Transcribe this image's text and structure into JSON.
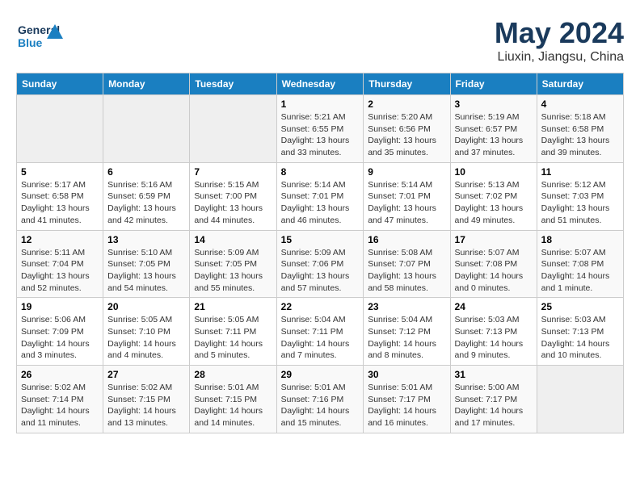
{
  "header": {
    "logo_line1": "General",
    "logo_line2": "Blue",
    "title": "May 2024",
    "subtitle": "Liuxin, Jiangsu, China"
  },
  "weekdays": [
    "Sunday",
    "Monday",
    "Tuesday",
    "Wednesday",
    "Thursday",
    "Friday",
    "Saturday"
  ],
  "weeks": [
    [
      {
        "day": "",
        "detail": ""
      },
      {
        "day": "",
        "detail": ""
      },
      {
        "day": "",
        "detail": ""
      },
      {
        "day": "1",
        "detail": "Sunrise: 5:21 AM\nSunset: 6:55 PM\nDaylight: 13 hours\nand 33 minutes."
      },
      {
        "day": "2",
        "detail": "Sunrise: 5:20 AM\nSunset: 6:56 PM\nDaylight: 13 hours\nand 35 minutes."
      },
      {
        "day": "3",
        "detail": "Sunrise: 5:19 AM\nSunset: 6:57 PM\nDaylight: 13 hours\nand 37 minutes."
      },
      {
        "day": "4",
        "detail": "Sunrise: 5:18 AM\nSunset: 6:58 PM\nDaylight: 13 hours\nand 39 minutes."
      }
    ],
    [
      {
        "day": "5",
        "detail": "Sunrise: 5:17 AM\nSunset: 6:58 PM\nDaylight: 13 hours\nand 41 minutes."
      },
      {
        "day": "6",
        "detail": "Sunrise: 5:16 AM\nSunset: 6:59 PM\nDaylight: 13 hours\nand 42 minutes."
      },
      {
        "day": "7",
        "detail": "Sunrise: 5:15 AM\nSunset: 7:00 PM\nDaylight: 13 hours\nand 44 minutes."
      },
      {
        "day": "8",
        "detail": "Sunrise: 5:14 AM\nSunset: 7:01 PM\nDaylight: 13 hours\nand 46 minutes."
      },
      {
        "day": "9",
        "detail": "Sunrise: 5:14 AM\nSunset: 7:01 PM\nDaylight: 13 hours\nand 47 minutes."
      },
      {
        "day": "10",
        "detail": "Sunrise: 5:13 AM\nSunset: 7:02 PM\nDaylight: 13 hours\nand 49 minutes."
      },
      {
        "day": "11",
        "detail": "Sunrise: 5:12 AM\nSunset: 7:03 PM\nDaylight: 13 hours\nand 51 minutes."
      }
    ],
    [
      {
        "day": "12",
        "detail": "Sunrise: 5:11 AM\nSunset: 7:04 PM\nDaylight: 13 hours\nand 52 minutes."
      },
      {
        "day": "13",
        "detail": "Sunrise: 5:10 AM\nSunset: 7:05 PM\nDaylight: 13 hours\nand 54 minutes."
      },
      {
        "day": "14",
        "detail": "Sunrise: 5:09 AM\nSunset: 7:05 PM\nDaylight: 13 hours\nand 55 minutes."
      },
      {
        "day": "15",
        "detail": "Sunrise: 5:09 AM\nSunset: 7:06 PM\nDaylight: 13 hours\nand 57 minutes."
      },
      {
        "day": "16",
        "detail": "Sunrise: 5:08 AM\nSunset: 7:07 PM\nDaylight: 13 hours\nand 58 minutes."
      },
      {
        "day": "17",
        "detail": "Sunrise: 5:07 AM\nSunset: 7:08 PM\nDaylight: 14 hours\nand 0 minutes."
      },
      {
        "day": "18",
        "detail": "Sunrise: 5:07 AM\nSunset: 7:08 PM\nDaylight: 14 hours\nand 1 minute."
      }
    ],
    [
      {
        "day": "19",
        "detail": "Sunrise: 5:06 AM\nSunset: 7:09 PM\nDaylight: 14 hours\nand 3 minutes."
      },
      {
        "day": "20",
        "detail": "Sunrise: 5:05 AM\nSunset: 7:10 PM\nDaylight: 14 hours\nand 4 minutes."
      },
      {
        "day": "21",
        "detail": "Sunrise: 5:05 AM\nSunset: 7:11 PM\nDaylight: 14 hours\nand 5 minutes."
      },
      {
        "day": "22",
        "detail": "Sunrise: 5:04 AM\nSunset: 7:11 PM\nDaylight: 14 hours\nand 7 minutes."
      },
      {
        "day": "23",
        "detail": "Sunrise: 5:04 AM\nSunset: 7:12 PM\nDaylight: 14 hours\nand 8 minutes."
      },
      {
        "day": "24",
        "detail": "Sunrise: 5:03 AM\nSunset: 7:13 PM\nDaylight: 14 hours\nand 9 minutes."
      },
      {
        "day": "25",
        "detail": "Sunrise: 5:03 AM\nSunset: 7:13 PM\nDaylight: 14 hours\nand 10 minutes."
      }
    ],
    [
      {
        "day": "26",
        "detail": "Sunrise: 5:02 AM\nSunset: 7:14 PM\nDaylight: 14 hours\nand 11 minutes."
      },
      {
        "day": "27",
        "detail": "Sunrise: 5:02 AM\nSunset: 7:15 PM\nDaylight: 14 hours\nand 13 minutes."
      },
      {
        "day": "28",
        "detail": "Sunrise: 5:01 AM\nSunset: 7:15 PM\nDaylight: 14 hours\nand 14 minutes."
      },
      {
        "day": "29",
        "detail": "Sunrise: 5:01 AM\nSunset: 7:16 PM\nDaylight: 14 hours\nand 15 minutes."
      },
      {
        "day": "30",
        "detail": "Sunrise: 5:01 AM\nSunset: 7:17 PM\nDaylight: 14 hours\nand 16 minutes."
      },
      {
        "day": "31",
        "detail": "Sunrise: 5:00 AM\nSunset: 7:17 PM\nDaylight: 14 hours\nand 17 minutes."
      },
      {
        "day": "",
        "detail": ""
      }
    ]
  ]
}
